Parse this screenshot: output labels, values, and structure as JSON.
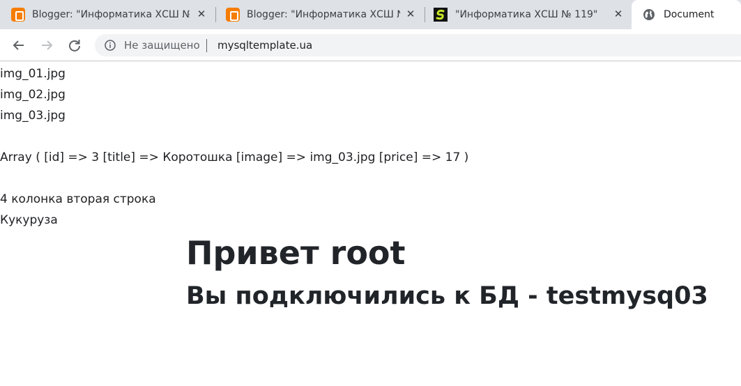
{
  "browser": {
    "tabs": [
      {
        "title": "Blogger: \"Информатика ХСШ №",
        "icon": "blogger-icon",
        "close": "✕"
      },
      {
        "title": "Blogger: \"Информатика ХСШ №",
        "icon": "blogger-icon",
        "close": "✕"
      },
      {
        "title": "\"Информатика ХСШ № 119\"",
        "icon": "site-s-icon",
        "close": "✕"
      },
      {
        "title": "Document",
        "icon": "globe-icon"
      }
    ],
    "security_label": "Не защищено",
    "url": "mysqltemplate.ua"
  },
  "page": {
    "lines": [
      "img_01.jpg",
      "img_02.jpg",
      "img_03.jpg",
      "Array ( [id] => 3 [title] => Коротошка [image] => img_03.jpg [price] => 17 )",
      "4 колонка вторая строка",
      "Кукуруза"
    ],
    "greeting": "Привет root",
    "db_message": "Вы подключились к БД - testmysq03"
  },
  "colors": {
    "tabstrip": "#dee1e6",
    "blogger": "#f57d00",
    "text": "#202124"
  }
}
